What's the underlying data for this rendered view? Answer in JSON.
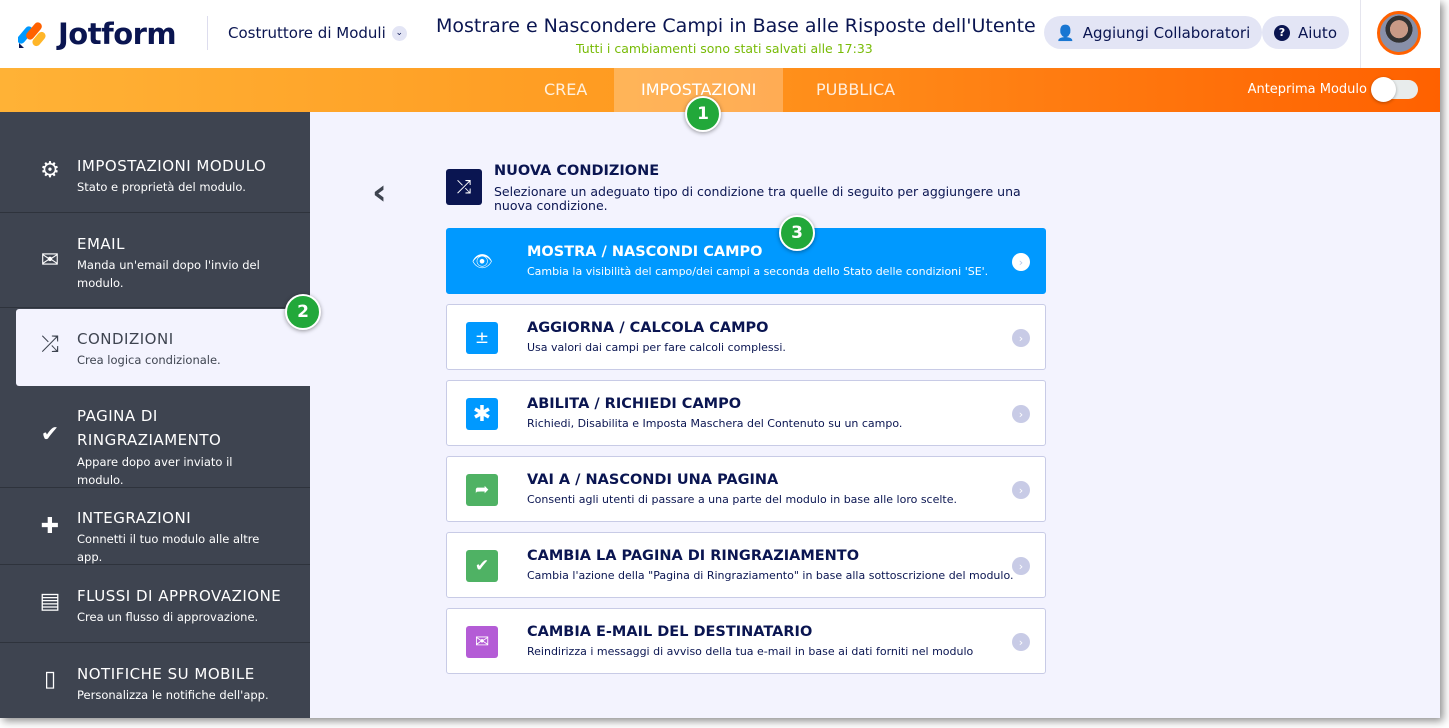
{
  "header": {
    "logo": "Jotform",
    "builder": "Costruttore di Moduli",
    "title": "Mostrare e Nascondere Campi in Base alle Risposte dell'Utente",
    "saved": "Tutti i cambiamenti sono stati salvati alle 17:33",
    "collab": "Aggiungi Collaboratori",
    "help": "Aiuto"
  },
  "nav": {
    "tabs": [
      "CREA",
      "IMPOSTAZIONI",
      "PUBBLICA"
    ],
    "preview": "Anteprima Modulo"
  },
  "badges": [
    "1",
    "2",
    "3"
  ],
  "sidebar": [
    {
      "title": "IMPOSTAZIONI MODULO",
      "desc": "Stato e proprietà del modulo.",
      "icon": "gear-icon"
    },
    {
      "title": "EMAIL",
      "desc": "Manda un'email dopo l'invio del modulo.",
      "icon": "envelope-icon"
    },
    {
      "title": "CONDIZIONI",
      "desc": "Crea logica condizionale.",
      "icon": "shuffle-icon"
    },
    {
      "title": "PAGINA DI RINGRAZIAMENTO",
      "desc": "Appare dopo aver inviato il modulo.",
      "icon": "check-circle-icon"
    },
    {
      "title": "INTEGRAZIONI",
      "desc": "Connetti il tuo modulo alle altre app.",
      "icon": "puzzle-icon"
    },
    {
      "title": "FLUSSI DI APPROVAZIONE",
      "desc": "Crea un flusso di approvazione.",
      "icon": "approval-icon"
    },
    {
      "title": "NOTIFICHE SU MOBILE",
      "desc": "Personalizza le notifiche dell'app.",
      "icon": "mobile-icon"
    }
  ],
  "main": {
    "title": "NUOVA CONDIZIONE",
    "desc": "Selezionare un adeguato tipo di condizione tra quelle di seguito per aggiungere una nuova condizione.",
    "cards": [
      {
        "title": "MOSTRA / NASCONDI CAMPO",
        "desc": "Cambia la visibilità del campo/dei campi a seconda dello Stato delle condizioni 'SE'.",
        "color": "#0099ff"
      },
      {
        "title": "AGGIORNA / CALCOLA CAMPO",
        "desc": "Usa valori dai campi per fare calcoli complessi.",
        "color": "#0099ff"
      },
      {
        "title": "ABILITA / RICHIEDI CAMPO",
        "desc": "Richiedi, Disabilita e Imposta Maschera del Contenuto su un campo.",
        "color": "#0099ff"
      },
      {
        "title": "VAI A / NASCONDI UNA PAGINA",
        "desc": "Consenti agli utenti di passare a una parte del modulo in base alle loro scelte.",
        "color": "#4fb264"
      },
      {
        "title": "CAMBIA LA PAGINA DI RINGRAZIAMENTO",
        "desc": "Cambia l'azione della \"Pagina di Ringraziamento\" in base alla sottoscrizione del modulo.",
        "color": "#4fb264"
      },
      {
        "title": "CAMBIA E-MAIL DEL DESTINATARIO",
        "desc": "Reindirizza i messaggi di avviso della tua e-mail in base ai dati forniti nel modulo",
        "color": "#b45cd6"
      }
    ]
  }
}
